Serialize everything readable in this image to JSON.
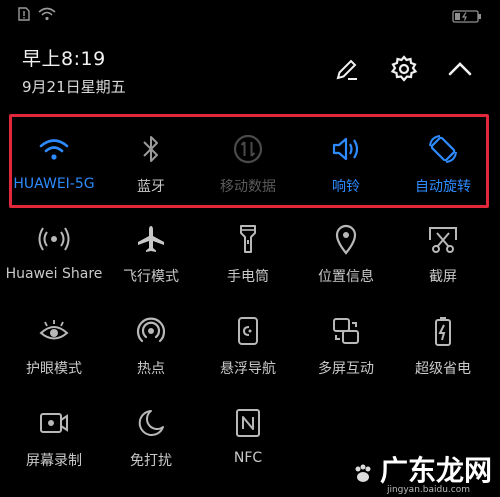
{
  "status_bar": {
    "left_icons": [
      "sim-alert-icon",
      "wifi-icon"
    ],
    "right_icons": [
      "battery-icon"
    ]
  },
  "header": {
    "time": "早上8:19",
    "date": "9月21日星期五"
  },
  "header_buttons": [
    "edit-icon",
    "settings-icon",
    "collapse-icon"
  ],
  "colors": {
    "accent": "#2e8bff",
    "highlight_border": "#e0283a",
    "background": "#000000"
  },
  "rows": [
    [
      {
        "name": "wifi",
        "label": "HUAWEI-5G",
        "state": "on"
      },
      {
        "name": "bluetooth",
        "label": "蓝牙",
        "state": "off"
      },
      {
        "name": "mobile-data",
        "label": "移动数据",
        "state": "disabled"
      },
      {
        "name": "sound",
        "label": "响铃",
        "state": "on"
      },
      {
        "name": "auto-rotate",
        "label": "自动旋转",
        "state": "on"
      }
    ],
    [
      {
        "name": "huawei-share",
        "label": "Huawei Share",
        "state": "off"
      },
      {
        "name": "airplane-mode",
        "label": "飞行模式",
        "state": "off"
      },
      {
        "name": "flashlight",
        "label": "手电筒",
        "state": "off"
      },
      {
        "name": "location",
        "label": "位置信息",
        "state": "off"
      },
      {
        "name": "screenshot",
        "label": "截屏",
        "state": "off"
      }
    ],
    [
      {
        "name": "eye-comfort",
        "label": "护眼模式",
        "state": "off"
      },
      {
        "name": "hotspot",
        "label": "热点",
        "state": "off"
      },
      {
        "name": "floating-dock",
        "label": "悬浮导航",
        "state": "off"
      },
      {
        "name": "multi-screen",
        "label": "多屏互动",
        "state": "off"
      },
      {
        "name": "ultra-power-saving",
        "label": "超级省电",
        "state": "off"
      }
    ],
    [
      {
        "name": "screen-recorder",
        "label": "屏幕录制",
        "state": "off"
      },
      {
        "name": "do-not-disturb",
        "label": "免打扰",
        "state": "off"
      },
      {
        "name": "nfc",
        "label": "NFC",
        "state": "off"
      }
    ]
  ],
  "watermark": {
    "text": "广东龙网",
    "subtext": "jingyan.baidu.com"
  }
}
